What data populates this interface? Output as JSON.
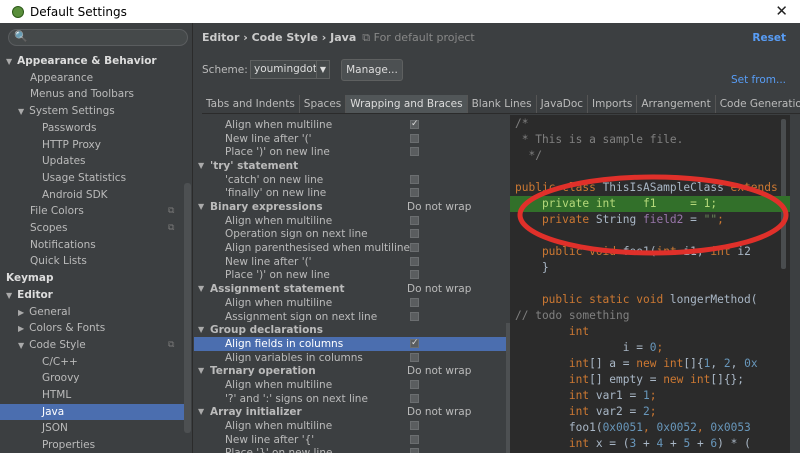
{
  "window": {
    "title": "Default Settings",
    "close": "✕"
  },
  "search": {
    "icon": "🔍",
    "placeholder": ""
  },
  "sidebar": {
    "items": [
      {
        "label": "Appearance & Behavior",
        "level": 0,
        "expanded": true,
        "bold": true
      },
      {
        "label": "Appearance",
        "level": 2
      },
      {
        "label": "Menus and Toolbars",
        "level": 2
      },
      {
        "label": "System Settings",
        "level": 1,
        "expanded": true
      },
      {
        "label": "Passwords",
        "level": 3
      },
      {
        "label": "HTTP Proxy",
        "level": 3
      },
      {
        "label": "Updates",
        "level": 3
      },
      {
        "label": "Usage Statistics",
        "level": 3
      },
      {
        "label": "Android SDK",
        "level": 3
      },
      {
        "label": "File Colors",
        "level": 2,
        "badge": "⧉"
      },
      {
        "label": "Scopes",
        "level": 2,
        "badge": "⧉"
      },
      {
        "label": "Notifications",
        "level": 2
      },
      {
        "label": "Quick Lists",
        "level": 2
      },
      {
        "label": "Keymap",
        "level": 0,
        "bold": true
      },
      {
        "label": "Editor",
        "level": 0,
        "expanded": true,
        "bold": true
      },
      {
        "label": "General",
        "level": 1,
        "collapsed": true
      },
      {
        "label": "Colors & Fonts",
        "level": 1,
        "collapsed": true
      },
      {
        "label": "Code Style",
        "level": 1,
        "expanded": true,
        "badge": "⧉"
      },
      {
        "label": "C/C++",
        "level": 3
      },
      {
        "label": "Groovy",
        "level": 3
      },
      {
        "label": "HTML",
        "level": 3
      },
      {
        "label": "Java",
        "level": 3,
        "selected": true
      },
      {
        "label": "JSON",
        "level": 3
      },
      {
        "label": "Properties",
        "level": 3
      }
    ]
  },
  "breadcrumb": {
    "path": "Editor › Code Style › Java",
    "note": "For default project"
  },
  "reset": "Reset",
  "scheme": {
    "label": "Scheme:",
    "value": "youmingdot",
    "manage": "Manage...",
    "set_from": "Set from..."
  },
  "tabs": [
    "Tabs and Indents",
    "Spaces",
    "Wrapping and Braces",
    "Blank Lines",
    "JavaDoc",
    "Imports",
    "Arrangement",
    "Code Generation"
  ],
  "active_tab": 2,
  "options": [
    {
      "label": "Align when multiline",
      "indent": 1,
      "checked": true
    },
    {
      "label": "New line after '('",
      "indent": 1,
      "checked": false
    },
    {
      "label": "Place ')' on new line",
      "indent": 1,
      "checked": false
    },
    {
      "label": "'try' statement",
      "indent": 0,
      "group": true
    },
    {
      "label": "'catch' on new line",
      "indent": 1,
      "checked": false
    },
    {
      "label": "'finally' on new line",
      "indent": 1,
      "checked": false
    },
    {
      "label": "Binary expressions",
      "indent": 0,
      "group": true,
      "value": "Do not wrap"
    },
    {
      "label": "Align when multiline",
      "indent": 1,
      "checked": false
    },
    {
      "label": "Operation sign on next line",
      "indent": 1,
      "checked": false
    },
    {
      "label": "Align parenthesised when multiline",
      "indent": 1,
      "checked": false
    },
    {
      "label": "New line after '('",
      "indent": 1,
      "checked": false
    },
    {
      "label": "Place ')' on new line",
      "indent": 1,
      "checked": false
    },
    {
      "label": "Assignment statement",
      "indent": 0,
      "group": true,
      "value": "Do not wrap"
    },
    {
      "label": "Align when multiline",
      "indent": 1,
      "checked": false
    },
    {
      "label": "Assignment sign on next line",
      "indent": 1,
      "checked": false
    },
    {
      "label": "Group declarations",
      "indent": 0,
      "group": true
    },
    {
      "label": "Align fields in columns",
      "indent": 1,
      "checked": true,
      "selected": true
    },
    {
      "label": "Align variables in columns",
      "indent": 1,
      "checked": false
    },
    {
      "label": "Ternary operation",
      "indent": 0,
      "group": true,
      "value": "Do not wrap"
    },
    {
      "label": "Align when multiline",
      "indent": 1,
      "checked": false
    },
    {
      "label": "'?' and ':' signs on next line",
      "indent": 1,
      "checked": false
    },
    {
      "label": "Array initializer",
      "indent": 0,
      "group": true,
      "value": "Do not wrap"
    },
    {
      "label": "Align when multiline",
      "indent": 1,
      "checked": false
    },
    {
      "label": "New line after '{'",
      "indent": 1,
      "checked": false
    },
    {
      "label": "Place '}' on new line",
      "indent": 1,
      "checked": false
    }
  ],
  "code": [
    {
      "row": 0,
      "tokens": [
        [
          "/*",
          "cm"
        ]
      ]
    },
    {
      "row": 1,
      "tokens": [
        [
          " * This is a sample file.",
          "cm"
        ]
      ]
    },
    {
      "row": 2,
      "tokens": [
        [
          "  */",
          "cm"
        ]
      ]
    },
    {
      "row": 4,
      "tokens": [
        [
          "public class ",
          "kw"
        ],
        [
          "ThisIsASampleClass ",
          ""
        ],
        [
          "extends",
          "kw"
        ]
      ]
    },
    {
      "row": 5,
      "hl": true,
      "tokens": [
        [
          "    private int    f1     = 1;",
          ""
        ]
      ]
    },
    {
      "row": 6,
      "tokens": [
        [
          "    private ",
          "kw"
        ],
        [
          "String ",
          ""
        ],
        [
          "field2",
          "fld"
        ],
        [
          " = ",
          ""
        ],
        [
          "\"\"",
          "str"
        ],
        [
          ";",
          "kw"
        ]
      ]
    },
    {
      "row": 8,
      "tokens": [
        [
          "    public void ",
          "kw"
        ],
        [
          "foo1(",
          ""
        ],
        [
          "int ",
          "kw"
        ],
        [
          "i1, ",
          ""
        ],
        [
          "int ",
          "kw"
        ],
        [
          "i2",
          ""
        ]
      ]
    },
    {
      "row": 9,
      "tokens": [
        [
          "    }",
          ""
        ]
      ]
    },
    {
      "row": 11,
      "tokens": [
        [
          "    public static void ",
          "kw"
        ],
        [
          "longerMethod(",
          ""
        ]
      ]
    },
    {
      "row": 12,
      "tokens": [
        [
          "// todo something",
          "cm"
        ]
      ]
    },
    {
      "row": 13,
      "tokens": [
        [
          "        int",
          "kw"
        ]
      ]
    },
    {
      "row": 14,
      "tokens": [
        [
          "                i = ",
          ""
        ],
        [
          "0",
          "num"
        ],
        [
          ";",
          "kw"
        ]
      ]
    },
    {
      "row": 15,
      "tokens": [
        [
          "        int",
          "kw"
        ],
        [
          "[] a = ",
          ""
        ],
        [
          "new int",
          "kw"
        ],
        [
          "[]{",
          ""
        ],
        [
          "1",
          "num"
        ],
        [
          ", ",
          ""
        ],
        [
          "2",
          "num"
        ],
        [
          ", ",
          ""
        ],
        [
          "0x",
          "num"
        ]
      ]
    },
    {
      "row": 16,
      "tokens": [
        [
          "        int",
          "kw"
        ],
        [
          "[] empty = ",
          ""
        ],
        [
          "new int",
          "kw"
        ],
        [
          "[]{};",
          ""
        ]
      ]
    },
    {
      "row": 17,
      "tokens": [
        [
          "        int ",
          "kw"
        ],
        [
          "var1 = ",
          ""
        ],
        [
          "1",
          "num"
        ],
        [
          ";",
          "kw"
        ]
      ]
    },
    {
      "row": 18,
      "tokens": [
        [
          "        int ",
          "kw"
        ],
        [
          "var2 = ",
          ""
        ],
        [
          "2",
          "num"
        ],
        [
          ";",
          "kw"
        ]
      ]
    },
    {
      "row": 19,
      "tokens": [
        [
          "        foo1(",
          ""
        ],
        [
          "0x0051",
          "num"
        ],
        [
          ", ",
          "kw"
        ],
        [
          "0x0052",
          "num"
        ],
        [
          ", ",
          "kw"
        ],
        [
          "0x0053",
          "num"
        ]
      ]
    },
    {
      "row": 20,
      "tokens": [
        [
          "        int ",
          "kw"
        ],
        [
          "x = (",
          ""
        ],
        [
          "3",
          "num"
        ],
        [
          " + ",
          ""
        ],
        [
          "4",
          "num"
        ],
        [
          " + ",
          ""
        ],
        [
          "5",
          "num"
        ],
        [
          " + ",
          ""
        ],
        [
          "6",
          "num"
        ],
        [
          ") * (",
          ""
        ]
      ]
    }
  ],
  "annotation_color": "#e0302a"
}
